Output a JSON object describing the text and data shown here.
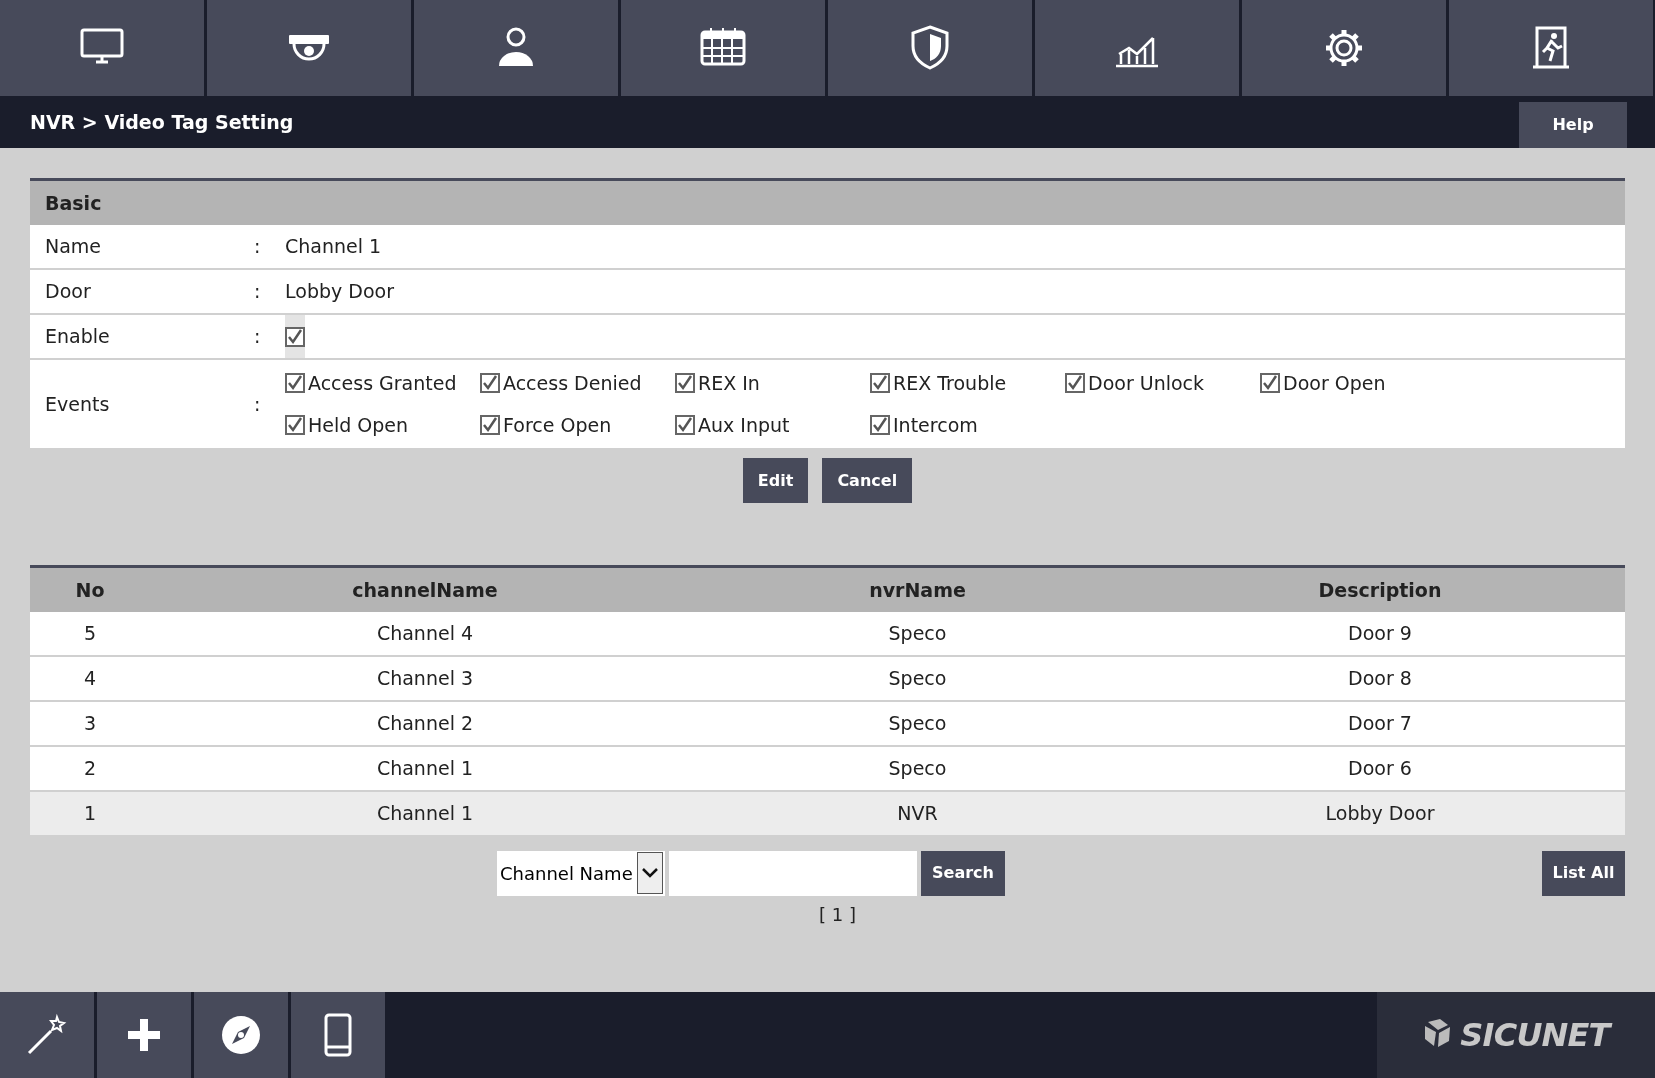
{
  "breadcrumb": "NVR > Video Tag Setting",
  "help_button": "Help",
  "basic": {
    "title": "Basic",
    "fields": [
      {
        "kind": "text",
        "label": "Name",
        "separator": ":",
        "value": "Channel 1"
      },
      {
        "kind": "text",
        "label": "Door",
        "separator": ":",
        "value": "Lobby Door"
      },
      {
        "kind": "checkbox",
        "label": "Enable",
        "separator": ":",
        "checked": true
      },
      {
        "kind": "events",
        "label": "Events",
        "separator": ":",
        "options": [
          {
            "label": "Access Granted",
            "checked": true
          },
          {
            "label": "Access Denied",
            "checked": true
          },
          {
            "label": "REX In",
            "checked": true
          },
          {
            "label": "REX Trouble",
            "checked": true
          },
          {
            "label": "Door Unlock",
            "checked": true
          },
          {
            "label": "Door Open",
            "checked": true
          },
          {
            "label": "Held Open",
            "checked": true
          },
          {
            "label": "Force Open",
            "checked": true
          },
          {
            "label": "Aux Input",
            "checked": true
          },
          {
            "label": "Intercom",
            "checked": true
          }
        ]
      }
    ],
    "buttons": [
      "Edit",
      "Cancel"
    ]
  },
  "table": {
    "columns": [
      "No",
      "channelName",
      "nvrName",
      "Description"
    ],
    "rows": [
      {
        "cells": [
          "5",
          "Channel 4",
          "Speco",
          "Door 9"
        ],
        "selected": false
      },
      {
        "cells": [
          "4",
          "Channel 3",
          "Speco",
          "Door 8"
        ],
        "selected": false
      },
      {
        "cells": [
          "3",
          "Channel 2",
          "Speco",
          "Door 7"
        ],
        "selected": false
      },
      {
        "cells": [
          "2",
          "Channel 1",
          "Speco",
          "Door 6"
        ],
        "selected": false
      },
      {
        "cells": [
          "1",
          "Channel 1",
          "NVR",
          "Lobby Door"
        ],
        "selected": true
      }
    ]
  },
  "search": {
    "filter": "Channel Name",
    "search_button": "Search",
    "list_all_button": "List All",
    "pagination": "[ 1 ]"
  },
  "footer": {
    "logo": "SICUNET"
  }
}
